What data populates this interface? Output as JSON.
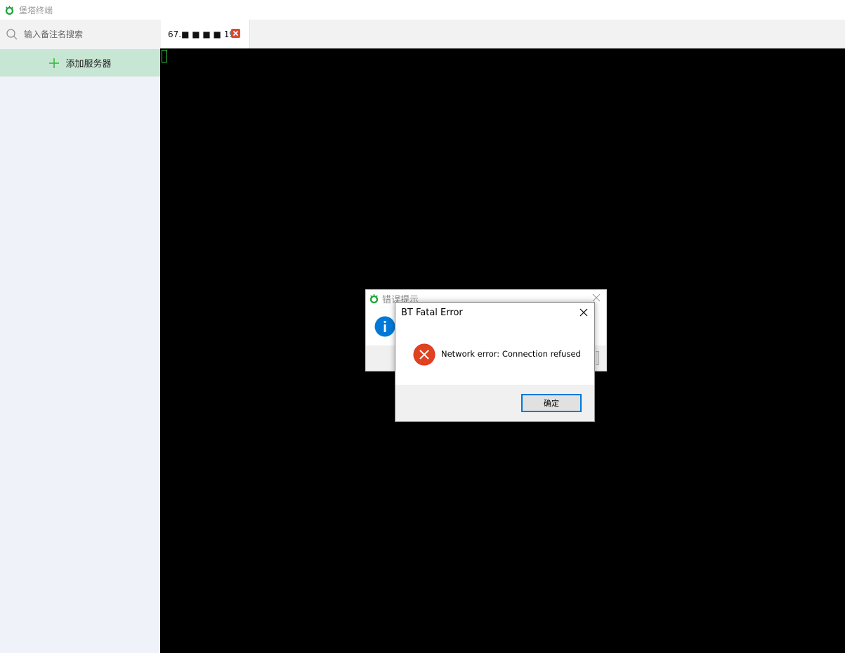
{
  "app": {
    "title": "堡塔终端",
    "logo_icon": "bt-logo-icon"
  },
  "sidebar": {
    "search": {
      "placeholder": "输入备注名搜索",
      "value": ""
    },
    "add_server_label": "添加服务器"
  },
  "tabs": [
    {
      "label": "67.■ ■ ■ ■ 194",
      "close_icon": "close-x-icon"
    }
  ],
  "dialogs": {
    "background": {
      "title": "错误提示",
      "icon": "info-icon"
    },
    "foreground": {
      "title": "BT Fatal Error",
      "message": "Network error: Connection refused",
      "ok_label": "确定",
      "icon": "error-icon"
    }
  },
  "colors": {
    "accent_green": "#2fbf3a",
    "add_server_bg": "#c8e6d4",
    "terminal_bg": "#000000",
    "error_red": "#e81123",
    "info_blue": "#0078d7"
  }
}
